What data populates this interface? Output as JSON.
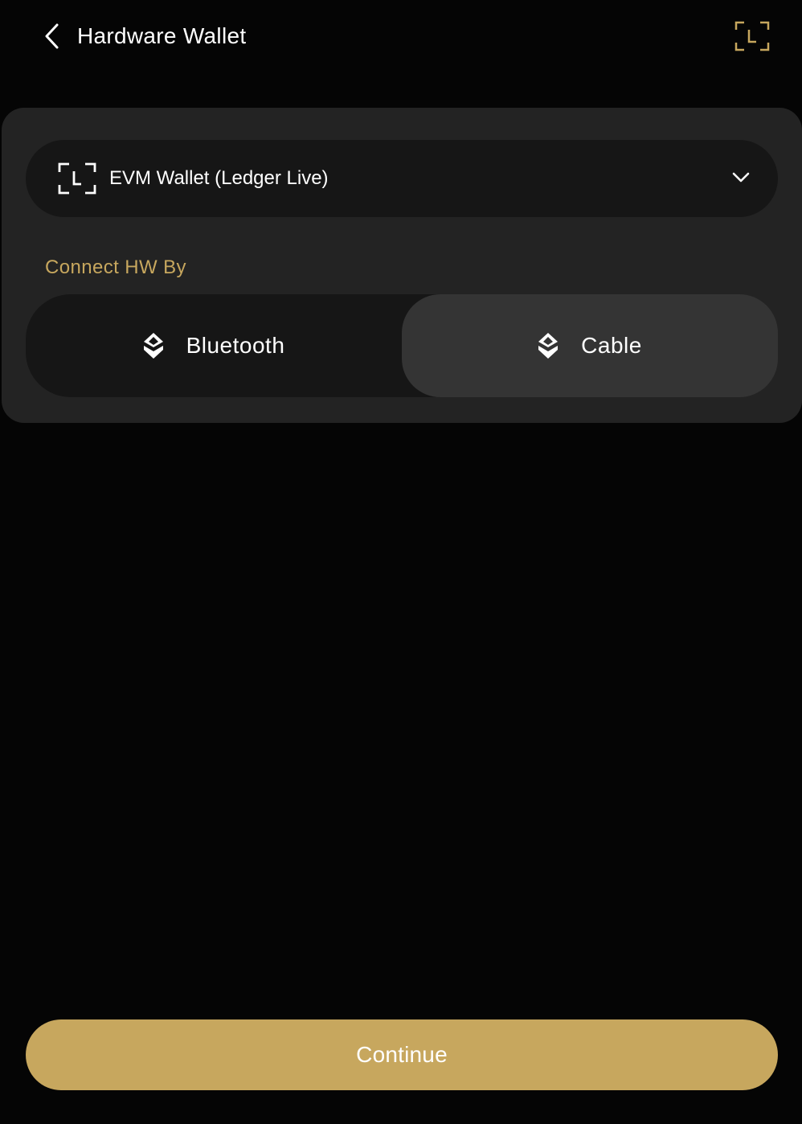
{
  "header": {
    "title": "Hardware Wallet",
    "back_icon": "chevron-left-icon",
    "action_icon": "ledger-icon"
  },
  "wallet_select": {
    "selected": "EVM Wallet (Ledger Live)",
    "icon": "ledger-icon",
    "dropdown_icon": "chevron-down-icon"
  },
  "connect": {
    "label": "Connect HW By",
    "options": [
      {
        "label": "Bluetooth",
        "icon": "connection-icon",
        "selected": false
      },
      {
        "label": "Cable",
        "icon": "connection-icon",
        "selected": true
      }
    ]
  },
  "footer": {
    "continue_label": "Continue"
  },
  "colors": {
    "background": "#050505",
    "card": "#232323",
    "input": "#161616",
    "selected_segment": "#343434",
    "accent": "#c7a75e",
    "text": "#ffffff"
  }
}
